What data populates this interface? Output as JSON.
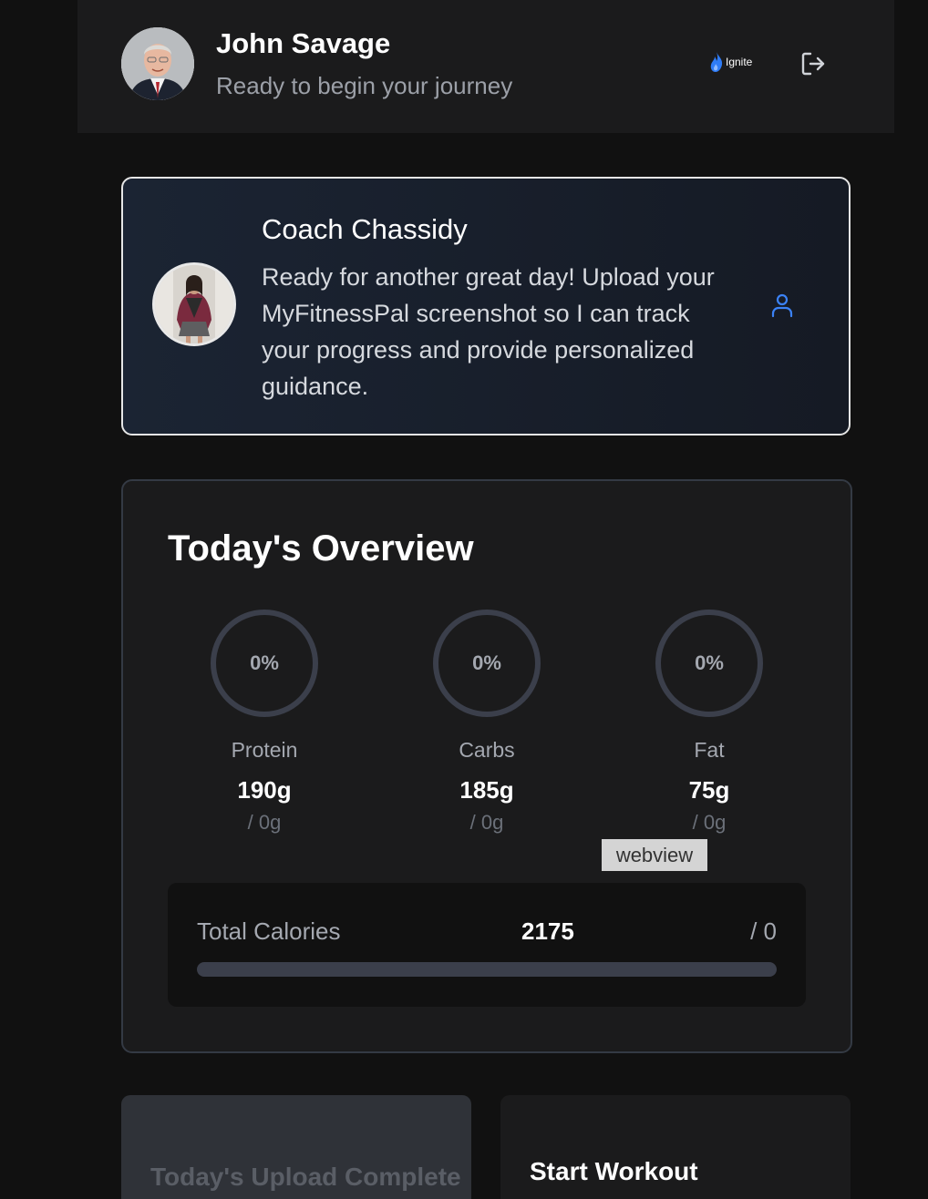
{
  "header": {
    "user_name": "John Savage",
    "subtitle": "Ready to begin your journey",
    "brand": "Ignite"
  },
  "coach": {
    "name": "Coach Chassidy",
    "message": "Ready for another great day! Upload your MyFitnessPal screenshot so I can track your progress and provide personalized guidance."
  },
  "overview": {
    "title": "Today's Overview",
    "macros": [
      {
        "name": "Protein",
        "percent": "0%",
        "value": "190g",
        "target": "/ 0g"
      },
      {
        "name": "Carbs",
        "percent": "0%",
        "value": "185g",
        "target": "/ 0g"
      },
      {
        "name": "Fat",
        "percent": "0%",
        "value": "75g",
        "target": "/ 0g"
      }
    ],
    "calories": {
      "label": "Total Calories",
      "value": "2175",
      "target": "/ 0",
      "progress": 0
    }
  },
  "tooltip": "webview",
  "cards": {
    "upload_label": "Today's Upload Complete",
    "workout_label": "Start Workout"
  },
  "colors": {
    "accent": "#3b82f6",
    "ring_track": "#3b3f4b",
    "background": "#111111",
    "card": "#1b1b1c"
  }
}
